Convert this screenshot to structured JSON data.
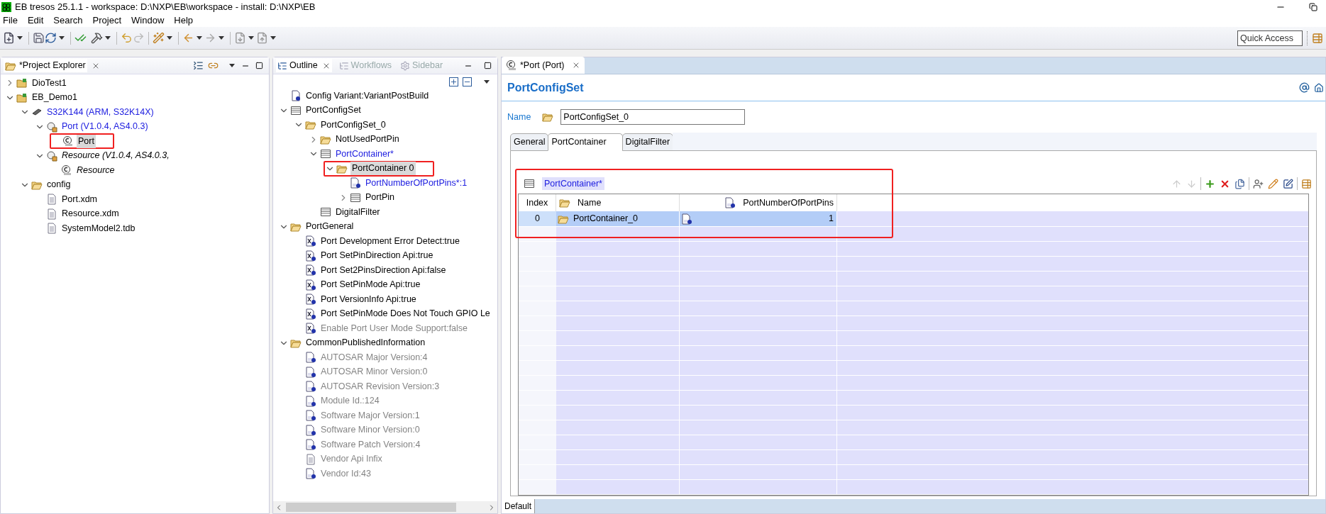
{
  "window": {
    "title": "EB tresos 25.1.1 - workspace: D:\\NXP\\EB\\workspace - install: D:\\NXP\\EB"
  },
  "menu": [
    {
      "label": "File"
    },
    {
      "label": "Edit"
    },
    {
      "label": "Search"
    },
    {
      "label": "Project"
    },
    {
      "label": "Window"
    },
    {
      "label": "Help"
    }
  ],
  "quick_access": {
    "placeholder": "Quick Access"
  },
  "project_explorer": {
    "tab": {
      "label": "*Project Explorer",
      "selected": true
    },
    "tree": [
      {
        "label": "DioTest1",
        "kind": "project",
        "expanded": false,
        "modified": false,
        "inactive": false,
        "disabled": false,
        "selected": false,
        "highlighted": false
      },
      {
        "label": "EB_Demo1",
        "kind": "project",
        "expanded": true,
        "modified": false,
        "inactive": false,
        "disabled": false,
        "selected": false,
        "highlighted": false,
        "children": [
          {
            "label": "S32K144 (ARM, S32K14X)",
            "kind": "chip",
            "expanded": true,
            "modified": true,
            "inactive": false,
            "disabled": false,
            "selected": false,
            "highlighted": false,
            "children": [
              {
                "label": "Port (V1.0.4, AS4.0.3)",
                "kind": "module",
                "expanded": true,
                "modified": true,
                "inactive": false,
                "disabled": false,
                "selected": false,
                "highlighted": false,
                "children": [
                  {
                    "label": "Port",
                    "kind": "config",
                    "modified": false,
                    "inactive": false,
                    "disabled": false,
                    "selected": true,
                    "highlighted": true
                  }
                ]
              },
              {
                "label": "Resource (V1.0.4, AS4.0.3,",
                "kind": "module",
                "expanded": true,
                "modified": false,
                "inactive": true,
                "disabled": false,
                "selected": false,
                "highlighted": false,
                "children": [
                  {
                    "label": "Resource",
                    "kind": "config",
                    "modified": false,
                    "inactive": true,
                    "disabled": false,
                    "selected": false,
                    "highlighted": false
                  }
                ]
              }
            ]
          },
          {
            "label": "config",
            "kind": "folder",
            "expanded": true,
            "modified": false,
            "inactive": false,
            "disabled": false,
            "selected": false,
            "highlighted": false,
            "children": [
              {
                "label": "Port.xdm",
                "kind": "file",
                "modified": false,
                "inactive": false,
                "disabled": false,
                "selected": false,
                "highlighted": false
              },
              {
                "label": "Resource.xdm",
                "kind": "file",
                "modified": false,
                "inactive": false,
                "disabled": false,
                "selected": false,
                "highlighted": false
              },
              {
                "label": "SystemModel2.tdb",
                "kind": "file",
                "modified": false,
                "inactive": false,
                "disabled": false,
                "selected": false,
                "highlighted": false
              }
            ]
          }
        ]
      }
    ]
  },
  "outline": {
    "tabs": [
      {
        "label": "Outline",
        "selected": true
      },
      {
        "label": "Workflows",
        "selected": false
      },
      {
        "label": "Sidebar",
        "selected": false
      }
    ],
    "tree": [
      {
        "label": "Config Variant:VariantPostBuild",
        "kind": "param",
        "modified": false,
        "inactive": false,
        "disabled": false,
        "selected": false,
        "highlighted": false
      },
      {
        "label": "PortConfigSet",
        "kind": "table",
        "expanded": true,
        "modified": false,
        "inactive": false,
        "disabled": false,
        "selected": false,
        "highlighted": false,
        "children": [
          {
            "label": "PortConfigSet_0",
            "kind": "folder",
            "expanded": true,
            "modified": false,
            "inactive": false,
            "disabled": false,
            "selected": false,
            "highlighted": false,
            "children": [
              {
                "label": "NotUsedPortPin",
                "kind": "folder",
                "expanded": false,
                "modified": false,
                "inactive": false,
                "disabled": false,
                "selected": false,
                "highlighted": false
              },
              {
                "label": "PortContainer*",
                "kind": "table",
                "expanded": true,
                "modified": true,
                "inactive": false,
                "disabled": false,
                "selected": false,
                "highlighted": false,
                "children": [
                  {
                    "label": "PortContainer 0",
                    "kind": "folder",
                    "expanded": true,
                    "modified": false,
                    "inactive": false,
                    "disabled": false,
                    "selected": true,
                    "highlighted": true,
                    "children": [
                      {
                        "label": "PortNumberOfPortPins*:1",
                        "kind": "int",
                        "modified": true,
                        "inactive": false,
                        "disabled": false,
                        "selected": false,
                        "highlighted": false
                      },
                      {
                        "label": "PortPin",
                        "kind": "table",
                        "expanded": false,
                        "modified": false,
                        "inactive": false,
                        "disabled": false,
                        "selected": false,
                        "highlighted": false
                      }
                    ]
                  }
                ]
              },
              {
                "label": "DigitalFilter",
                "kind": "table",
                "modified": false,
                "inactive": false,
                "disabled": false,
                "selected": false,
                "highlighted": false
              }
            ]
          }
        ]
      },
      {
        "label": "PortGeneral",
        "kind": "folder",
        "expanded": true,
        "modified": false,
        "inactive": false,
        "disabled": false,
        "selected": false,
        "highlighted": false,
        "children": [
          {
            "label": "Port Development Error Detect:true",
            "kind": "bool",
            "modified": false,
            "inactive": false,
            "disabled": false,
            "selected": false,
            "highlighted": false
          },
          {
            "label": "Port SetPinDirection Api:true",
            "kind": "bool",
            "modified": false,
            "inactive": false,
            "disabled": false,
            "selected": false,
            "highlighted": false
          },
          {
            "label": "Port Set2PinsDirection Api:false",
            "kind": "bool",
            "modified": false,
            "inactive": false,
            "disabled": false,
            "selected": false,
            "highlighted": false
          },
          {
            "label": "Port SetPinMode Api:true",
            "kind": "bool",
            "modified": false,
            "inactive": false,
            "disabled": false,
            "selected": false,
            "highlighted": false
          },
          {
            "label": "Port VersionInfo Api:true",
            "kind": "bool",
            "modified": false,
            "inactive": false,
            "disabled": false,
            "selected": false,
            "highlighted": false
          },
          {
            "label": "Port SetPinMode Does Not Touch GPIO Le",
            "kind": "bool",
            "modified": false,
            "inactive": false,
            "disabled": false,
            "selected": false,
            "highlighted": false
          },
          {
            "label": "Enable Port User Mode Support:false",
            "kind": "bool",
            "modified": false,
            "inactive": false,
            "disabled": true,
            "selected": false,
            "highlighted": false
          }
        ]
      },
      {
        "label": "CommonPublishedInformation",
        "kind": "folder",
        "expanded": true,
        "modified": false,
        "inactive": false,
        "disabled": false,
        "selected": false,
        "highlighted": false,
        "children": [
          {
            "label": "AUTOSAR Major Version:4",
            "kind": "int",
            "modified": false,
            "inactive": false,
            "disabled": true,
            "selected": false,
            "highlighted": false
          },
          {
            "label": "AUTOSAR Minor Version:0",
            "kind": "int",
            "modified": false,
            "inactive": false,
            "disabled": true,
            "selected": false,
            "highlighted": false
          },
          {
            "label": "AUTOSAR Revision Version:3",
            "kind": "int",
            "modified": false,
            "inactive": false,
            "disabled": true,
            "selected": false,
            "highlighted": false
          },
          {
            "label": "Module Id.:124",
            "kind": "int",
            "modified": false,
            "inactive": false,
            "disabled": true,
            "selected": false,
            "highlighted": false
          },
          {
            "label": "Software Major Version:1",
            "kind": "int",
            "modified": false,
            "inactive": false,
            "disabled": true,
            "selected": false,
            "highlighted": false
          },
          {
            "label": "Software Minor Version:0",
            "kind": "int",
            "modified": false,
            "inactive": false,
            "disabled": true,
            "selected": false,
            "highlighted": false
          },
          {
            "label": "Software Patch Version:4",
            "kind": "int",
            "modified": false,
            "inactive": false,
            "disabled": true,
            "selected": false,
            "highlighted": false
          },
          {
            "label": "Vendor Api Infix",
            "kind": "file",
            "modified": false,
            "inactive": false,
            "disabled": true,
            "selected": false,
            "highlighted": false
          },
          {
            "label": "Vendor Id:43",
            "kind": "int",
            "modified": false,
            "inactive": false,
            "disabled": true,
            "selected": false,
            "highlighted": false
          }
        ]
      }
    ]
  },
  "editor": {
    "tab": {
      "label": "*Port (Port)",
      "selected": true
    },
    "heading": "PortConfigSet",
    "name_field": {
      "label": "Name",
      "value": "PortConfigSet_0"
    },
    "subtabs": [
      {
        "label": "General",
        "selected": false
      },
      {
        "label": "PortContainer",
        "selected": true
      },
      {
        "label": "DigitalFilter",
        "selected": false
      }
    ],
    "table": {
      "title": "PortContainer*",
      "highlighted": true,
      "columns": [
        {
          "label": "Index"
        },
        {
          "label": "Name"
        },
        {
          "label": "PortNumberOfPortPins"
        }
      ],
      "rows": [
        {
          "index": "0",
          "name": "PortContainer_0",
          "value": "1",
          "selected": true
        }
      ]
    },
    "bottom_tab": {
      "label": "Default",
      "selected": true
    }
  }
}
